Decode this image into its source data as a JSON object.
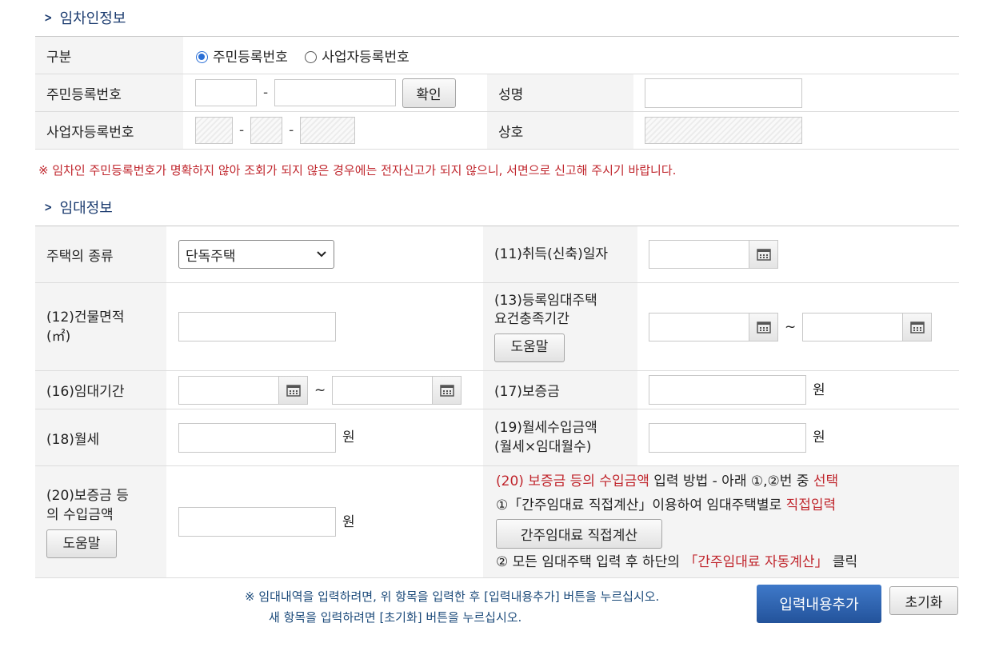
{
  "sections": {
    "tenant_title": "임차인정보",
    "rental_title": "임대정보"
  },
  "tenant": {
    "type_label": "구분",
    "radio_resident": "주민등록번호",
    "radio_business": "사업자등록번호",
    "resident_label": "주민등록번호",
    "confirm_button": "확인",
    "name_label": "성명",
    "business_label": "사업자등록번호",
    "company_label": "상호",
    "dash": "-"
  },
  "notice": "※ 임차인 주민등록번호가 명확하지 않아 조회가 되지 않은 경우에는 전자신고가 되지 않으니, 서면으로 신고해 주시기 바랍니다.",
  "rental": {
    "house_type_label": "주택의 종류",
    "house_type_value": "단독주택",
    "acq_date_label": "(11)취득(신축)일자",
    "area_label_1": "(12)건물면적",
    "area_label_2": "(㎡)",
    "period_req_label_1": "(13)등록임대주택",
    "period_req_label_2": "요건충족기간",
    "help_button": "도움말",
    "lease_period_label": "(16)임대기간",
    "deposit_label": "(17)보증금",
    "monthly_label": "(18)월세",
    "monthly_income_label_1": "(19)월세수입금액",
    "monthly_income_label_2": "(월세×임대월수)",
    "deposit_income_label_1": "(20)보증금 등",
    "deposit_income_label_2": "의 수입금액",
    "won": "원",
    "tilde": "~",
    "guide_1a": "(20) 보증금 등의 수입금액",
    "guide_1b": " 입력 방법 - 아래 ①,②번 중 ",
    "guide_1c": "선택",
    "guide_2a": "①「간주임대료 직접계산」이용하여 임대주택별로 ",
    "guide_2b": "직접입력",
    "calc_button": "간주임대료 직접계산",
    "guide_3a": "② 모든 임대주택 입력 후 하단의 ",
    "guide_3b": "「간주임대료 자동계산」",
    "guide_3c": " 클릭"
  },
  "bottom": {
    "note_1": "※ 임대내역을 입력하려면, 위 항목을 입력한 후 [입력내용추가] 버튼을 누르십시오.",
    "note_2": "새 항목을 입력하려면 [초기화] 버튼을 누르십시오.",
    "add_button": "입력내용추가",
    "reset_button": "초기화"
  },
  "colors": {
    "accent": "#1b3b6f",
    "notice_red": "#c0262d",
    "primary_button": "#2f63b0"
  }
}
